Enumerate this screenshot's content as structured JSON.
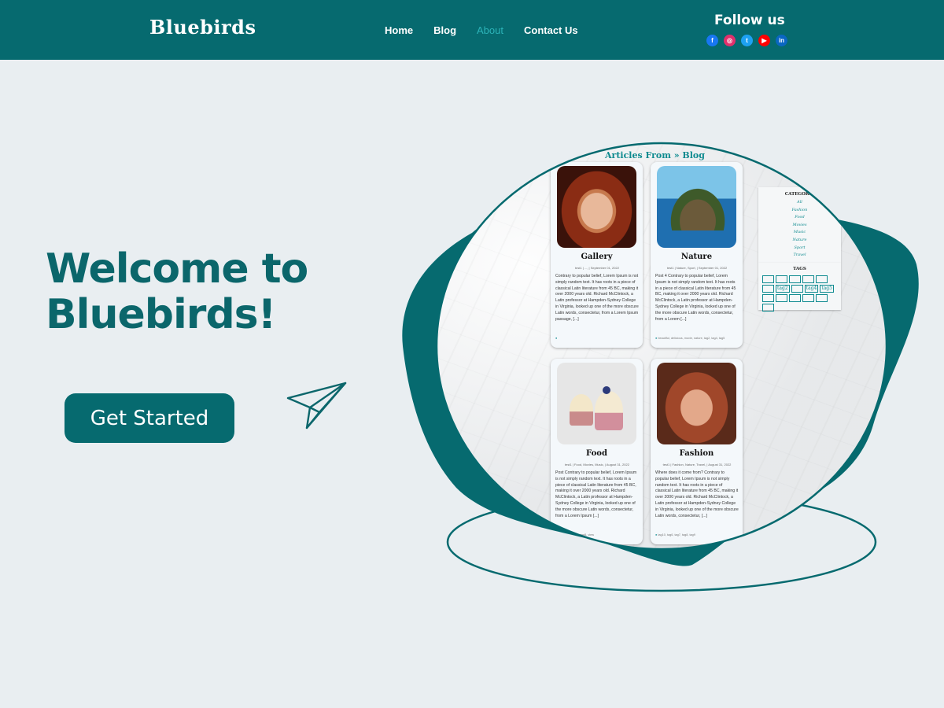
{
  "header": {
    "brand": "Bluebirds",
    "nav": [
      {
        "label": "Home",
        "active": false
      },
      {
        "label": "Blog",
        "active": false
      },
      {
        "label": "About",
        "active": true
      },
      {
        "label": "Contact Us",
        "active": false
      }
    ],
    "follow_label": "Follow us",
    "socials": [
      {
        "icon": "facebook-icon",
        "glyph": "f",
        "color": "#1877f2"
      },
      {
        "icon": "instagram-icon",
        "glyph": "◎",
        "color": "#e1306c"
      },
      {
        "icon": "twitter-icon",
        "glyph": "t",
        "color": "#1da1f2"
      },
      {
        "icon": "youtube-icon",
        "glyph": "▶",
        "color": "#ff0000"
      },
      {
        "icon": "linkedin-icon",
        "glyph": "in",
        "color": "#0a66c2"
      }
    ]
  },
  "hero": {
    "title_line1": "Welcome to",
    "title_line2": "Bluebirds!",
    "cta_label": "Get Started",
    "decor_icon": "paper-plane-icon"
  },
  "colors": {
    "primary": "#066a6f",
    "accent": "#2cb3b8",
    "background": "#e9eef1"
  },
  "mockup": {
    "title": "Articles From » Blog",
    "cards": [
      {
        "title": "Gallery",
        "meta": "test1 | ..., | September 01, 2022",
        "body": "Contrary to popular belief, Lorem Ipsum is not simply random text. It has roots in a piece of classical Latin literature from 45 BC, making it over 2000 years old. Richard McClintock, a Latin professor at Hampden-Sydney College in Virginia, looked up one of the more obscure Latin words, consectetur, from a Lorem Ipsum passage, [...]",
        "tags": ""
      },
      {
        "title": "Nature",
        "meta": "test1 | Nature, Sport, | September 01, 2022",
        "body": "Post 4 Contrary to popular belief, Lorem Ipsum is not simply random text. It has roots in a piece of classical Latin literature from 45 BC, making it over 2000 years old. Richard McClintock, a Latin professor at Hampden-Sydney College in Virginia, looked up one of the more obscure Latin words, consectetur, from a Lorem [...]",
        "tags": "beautiful, delicious, movie, nature, tag2, tag4, tag5"
      },
      {
        "title": "Food",
        "meta": "test1 | Food, Movies, Music, | August 31, 2022",
        "body": "Post Contrary to popular belief, Lorem Ipsum is not simply random text. It has roots in a piece of classical Latin literature from 45 BC, making it over 2000 years old. Richard McClintock, a Latin professor at Hampden-Sydney College in Virginia, looked up one of the more obscure Latin words, consectetur, from a Lorem Ipsum [...]",
        "tags": "tag2, tag3, tag4, tag5, view"
      },
      {
        "title": "Fashion",
        "meta": "test1 | Fashion, Nature, Travel, | August 31, 2022",
        "body": "Where does it come from? Contrary to popular belief, Lorem Ipsum is not simply random text. It has roots in a piece of classical Latin literature from 45 BC, making it over 2000 years old. Richard McClintock, a Latin professor at Hampden-Sydney College in Virginia, looked up one of the more obscure Latin words, consectetur, [...]",
        "tags": "tag10, tag6, tag7, tag8, tag9"
      }
    ],
    "categories_title": "CATEGORIE",
    "categories": [
      "All",
      "Fashion",
      "Food",
      "Movies",
      "Music",
      "Nature",
      "Sport",
      "Travel"
    ],
    "tags_title": "TAGS",
    "tag_chips": [
      "",
      "",
      "",
      "",
      "",
      "",
      "tag2",
      "",
      "tag4",
      "tag5",
      "",
      "",
      "",
      "",
      "",
      ""
    ]
  }
}
